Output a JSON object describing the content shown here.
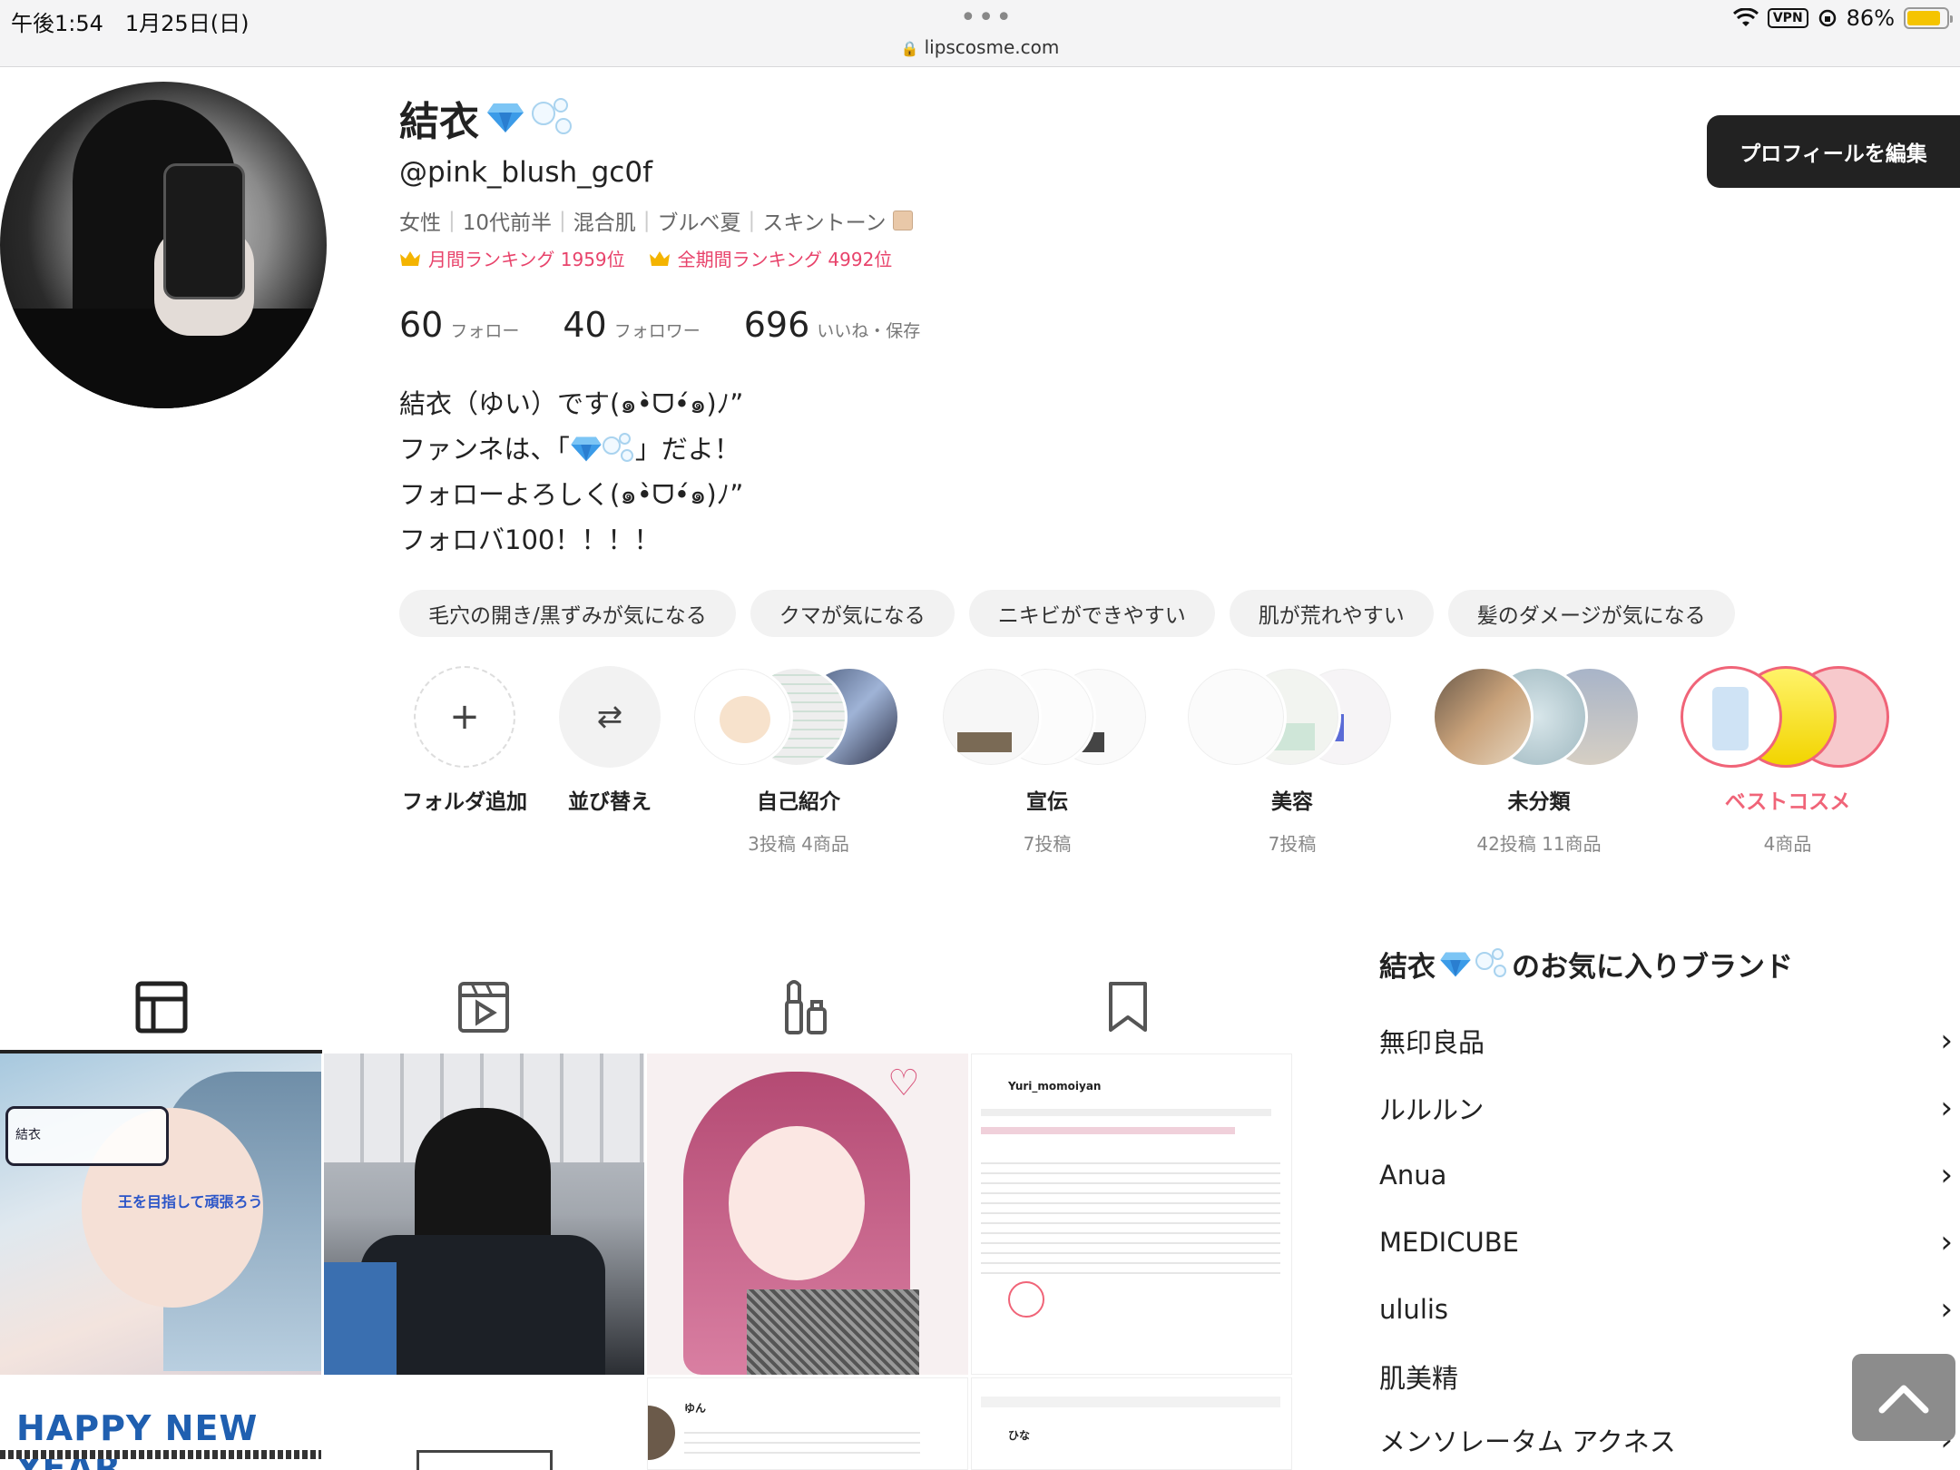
{
  "status_bar": {
    "time": "午後1:54　1月25日(日)",
    "url": "lipscosme.com",
    "vpn": "VPN",
    "battery": "86%",
    "battery_level": 0.86
  },
  "profile": {
    "name": "結衣",
    "handle": "@pink_blush_gc0f",
    "attributes": [
      "女性",
      "10代前半",
      "混合肌",
      "ブルベ夏",
      "スキントーン"
    ],
    "skin_tone_color": "#e9c8a8",
    "monthly_rank": "月間ランキング 1959位",
    "all_time_rank": "全期間ランキング 4992位",
    "edit_button": "プロフィールを編集"
  },
  "stats": [
    {
      "num": "60",
      "label": "フォロー"
    },
    {
      "num": "40",
      "label": "フォロワー"
    },
    {
      "num": "696",
      "label": "いいね・保存"
    }
  ],
  "bio": {
    "line1": "結衣（ゆい）です(๑•̀ᗜ•́๑)ﾉ”",
    "line2a": "ファンネは、「",
    "line2b": "」だよ！",
    "line3": "フォローよろしく(๑•̀ᗜ•́๑)ﾉ”",
    "line4": "フォロバ100！！！！"
  },
  "concern_tags": [
    "毛穴の開き/黒ずみが気になる",
    "クマが気になる",
    "ニキビができやすい",
    "肌が荒れやすい",
    "髪のダメージが気になる"
  ],
  "folders": {
    "add": "フォルダ追加",
    "sort": "並び替え",
    "items": [
      {
        "label": "自己紹介",
        "sub": "3投稿 4商品"
      },
      {
        "label": "宣伝",
        "sub": "7投稿"
      },
      {
        "label": "美容",
        "sub": "7投稿"
      },
      {
        "label": "未分類",
        "sub": "42投稿 11商品"
      },
      {
        "label": "ベストコスメ",
        "sub": "4商品"
      }
    ]
  },
  "posts": {
    "p1_caption": "結衣",
    "p1_text": "王を目指して頑張ろう",
    "p5_text": "HAPPY NEW YEAR",
    "p4_name": "Yuri_momoiyan",
    "p7_name": "ゆん",
    "p8_name": "ひな"
  },
  "brands": {
    "title_suffix": "のお気に入りブランド",
    "items": [
      "無印良品",
      "ルルルン",
      "Anua",
      "MEDICUBE",
      "ululis",
      "肌美精",
      "メンソレータム アクネス"
    ]
  },
  "colors": {
    "accent": "#e8436b",
    "dark": "#222222",
    "best_cosme": "#f06478"
  }
}
